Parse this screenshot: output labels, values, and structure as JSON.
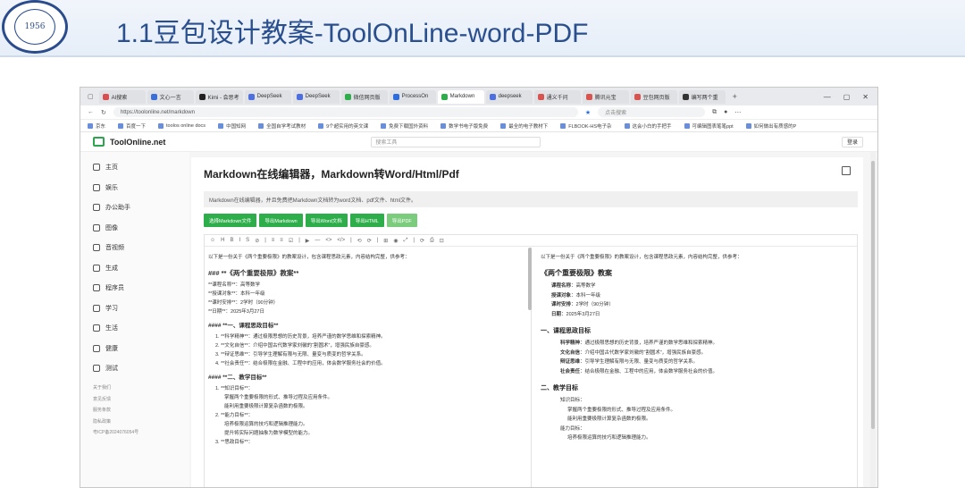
{
  "slide": {
    "title": "1.1豆包设计教案-ToolOnLine-word-PDF"
  },
  "browser": {
    "tabs": [
      {
        "label": "AI搜索",
        "color": "#d94f4f"
      },
      {
        "label": "文心一言",
        "color": "#3c6fd8"
      },
      {
        "label": "Kimi - 会思考",
        "color": "#222222"
      },
      {
        "label": "DeepSeek",
        "color": "#4e6fe0"
      },
      {
        "label": "DeepSeek",
        "color": "#4e6fe0"
      },
      {
        "label": "微信网页版",
        "color": "#2dae4a"
      },
      {
        "label": "ProcessOn",
        "color": "#2b6de0"
      },
      {
        "label": "Markdown",
        "color": "#2dae4a",
        "active": true
      },
      {
        "label": "deepseek",
        "color": "#4e6fe0"
      },
      {
        "label": "通义千问",
        "color": "#d9534f"
      },
      {
        "label": "腾讯元宝",
        "color": "#d9534f"
      },
      {
        "label": "豆包网页版",
        "color": "#d9534f"
      },
      {
        "label": "编写两个重",
        "color": "#333333"
      }
    ],
    "url": "https://toolonline.net/markdown",
    "search_placeholder": "点击搜索",
    "bookmarks": [
      "京东",
      "百度一下",
      "toolos online docs",
      "中国知网",
      "全国自学考试教材",
      "9个超实用的英文课",
      "免费下载国外资料",
      "数学书电子版免费",
      "最全的电子教材下",
      "FLBOOK-HS电子杂",
      "这会小白的手把手",
      "可编辑图表笔笔ppt",
      "如何做出有质感的P"
    ]
  },
  "site": {
    "name": "ToolOnline.net",
    "search_placeholder": "搜索工具",
    "login": "登录",
    "sidebar": [
      "主页",
      "娱乐",
      "办公助手",
      "图像",
      "音视频",
      "生成",
      "程序员",
      "学习",
      "生活",
      "健康",
      "测试"
    ],
    "footer_links": [
      "关于我们",
      "意见反馈",
      "服务条款",
      "隐私政策",
      "粤ICP备2024076054号"
    ],
    "main_title": "Markdown在线编辑器，Markdown转Word/Html/Pdf",
    "description": "Markdown在线编辑器，并且免费把Markdown文档转为word文档、pdf文件、html文件。",
    "buttons": [
      "选择Markdown文件",
      "导出Markdown",
      "导出Word文档",
      "导出HTML",
      "导出PDF"
    ]
  },
  "editor": {
    "toolbar": [
      "☺",
      "H",
      "B",
      "I",
      "S",
      "⊘",
      "|",
      "≡",
      "≡",
      "☑",
      "|",
      "▶",
      "—",
      "<>",
      "</>",
      "|",
      "⟲",
      "⟳",
      "|",
      "⊞",
      "◉",
      "⤢",
      "|",
      "⟳",
      "⎙",
      "⊡"
    ],
    "source": {
      "intro": "以下是一份关于《两个重要极限》的教案设计，包含课程思政元素，内容结构完整，供参考：",
      "h3": "### **《两个重要极限》教案**",
      "info": [
        "**课程名称**：高等数学",
        "**授课对象**：本科一年级",
        "**课时安排**：2学时（90分钟）",
        "**日期**：2025年3月27日"
      ],
      "h4a": "#### **一、课程思政目标**",
      "goals": [
        "1. **科学精神**：通过极限思想的历史背景，培养严谨的数学思维和探索精神。",
        "2. **文化自信**：介绍中国古代数学家刘徽的“割圆术”，增强民族自豪感。",
        "3. **辩证思维**：引导学生理解有限与无限、量变与质变的哲学关系。",
        "4. **社会责任**：结合极限在金融、工程中的应用，体会数学服务社会的价值。"
      ],
      "h4b": "#### **二、教学目标**",
      "teach": [
        "1. **知识目标**：",
        "掌握两个重要极限的形式、推导过程及应用条件。",
        "能利用重要极限计算复杂函数的极限。",
        "2. **能力目标**：",
        "培养极限运算的技巧和逻辑推理能力。",
        "提升将实际问题抽象为数学模型的能力。",
        "3. **思政目标**："
      ]
    },
    "preview": {
      "intro": "以下是一份关于《两个重要极限》的教案设计，包含课程思政元素，内容结构完整，供参考：",
      "h3": "《两个重要极限》教案",
      "info": [
        {
          "k": "课程名称",
          "v": "：高等数学"
        },
        {
          "k": "授课对象",
          "v": "：本科一年级"
        },
        {
          "k": "课时安排",
          "v": "：2学时（90分钟）"
        },
        {
          "k": "日期",
          "v": "：2025年3月27日"
        }
      ],
      "h4a": "一、课程思政目标",
      "goals": [
        {
          "k": "科学精神",
          "v": "：通过极限思想的历史背景，培养严谨的数学思维和探索精神。"
        },
        {
          "k": "文化自信",
          "v": "：介绍中国古代数学家刘徽的“割圆术”，增强民族自豪感。"
        },
        {
          "k": "辩证思维",
          "v": "：引导学生理解有限与无限、量变与质变的哲学关系。"
        },
        {
          "k": "社会责任",
          "v": "：结合极限在金融、工程中的应用，体会数学服务社会的价值。"
        }
      ],
      "h4b": "二、教学目标",
      "teach": [
        "知识目标：",
        "掌握两个重要极限的形式、推导过程及应用条件。",
        "能利用重要极限计算复杂函数的极限。",
        "能力目标：",
        "培养极限运算的技巧和逻辑推理能力。"
      ]
    }
  }
}
